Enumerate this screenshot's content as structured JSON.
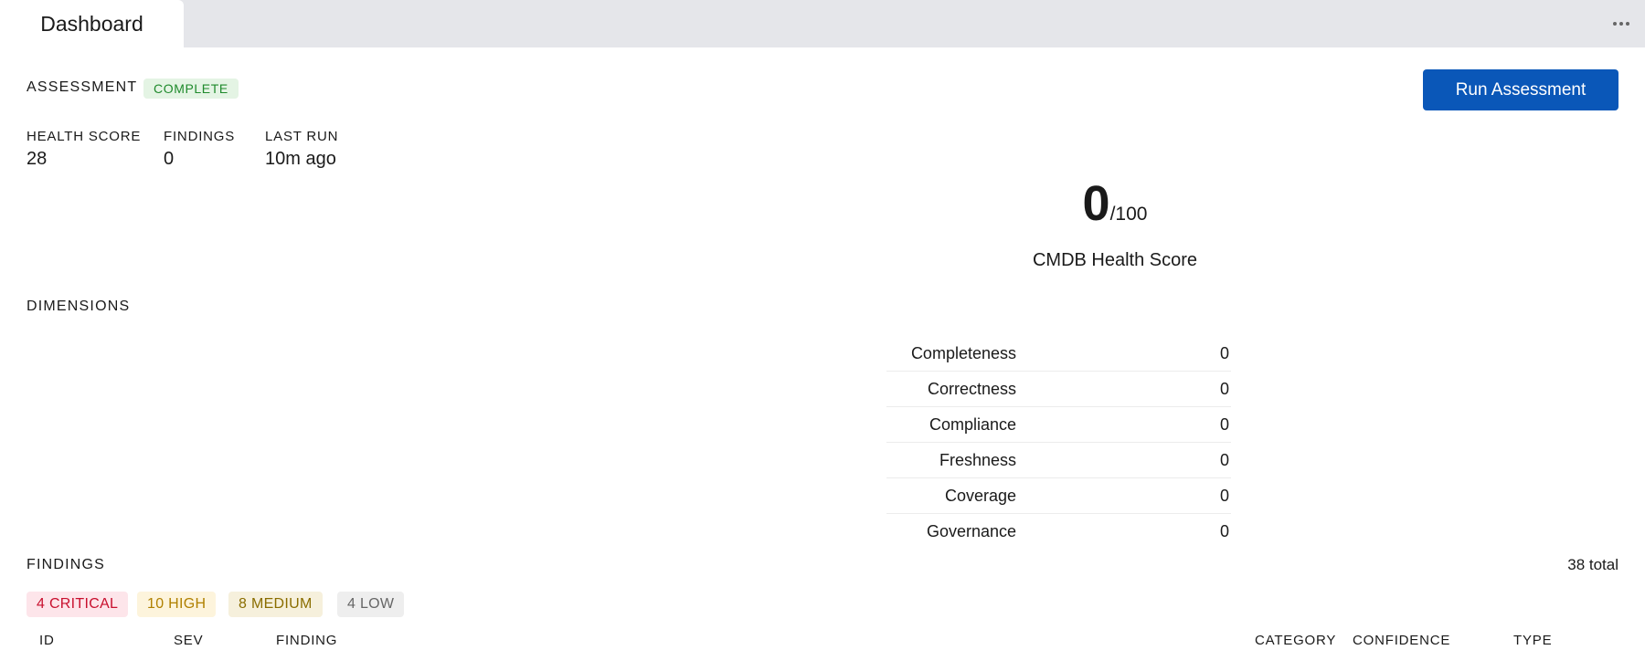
{
  "tabs": {
    "active_label": "Dashboard"
  },
  "assessment": {
    "label": "ASSESSMENT",
    "status_badge": "COMPLETE",
    "run_button": "Run Assessment"
  },
  "metrics": {
    "health_score_label": "HEALTH SCORE",
    "health_score_value": "28",
    "findings_label": "FINDINGS",
    "findings_value": "0",
    "last_run_label": "LAST RUN",
    "last_run_value": "10m ago"
  },
  "score": {
    "value": "0",
    "max": "/100",
    "caption": "CMDB Health Score"
  },
  "dimensions": {
    "label": "DIMENSIONS",
    "items": [
      {
        "name": "Completeness",
        "value": "0"
      },
      {
        "name": "Correctness",
        "value": "0"
      },
      {
        "name": "Compliance",
        "value": "0"
      },
      {
        "name": "Freshness",
        "value": "0"
      },
      {
        "name": "Coverage",
        "value": "0"
      },
      {
        "name": "Governance",
        "value": "0"
      }
    ]
  },
  "findings": {
    "label": "FINDINGS",
    "total": "38 total",
    "filters": {
      "critical": "4 CRITICAL",
      "high": "10 HIGH",
      "medium": "8 MEDIUM",
      "low": "4 LOW"
    },
    "columns": {
      "id": "ID",
      "sev": "SEV",
      "finding": "FINDING",
      "category": "CATEGORY",
      "confidence": "CONFIDENCE",
      "type": "TYPE"
    }
  },
  "colors": {
    "primary_button": "#0a57b8",
    "complete_badge": "#1f8a2c",
    "critical": "#c8102e",
    "high": "#b08000",
    "medium": "#8a6d00",
    "low": "#666666"
  }
}
